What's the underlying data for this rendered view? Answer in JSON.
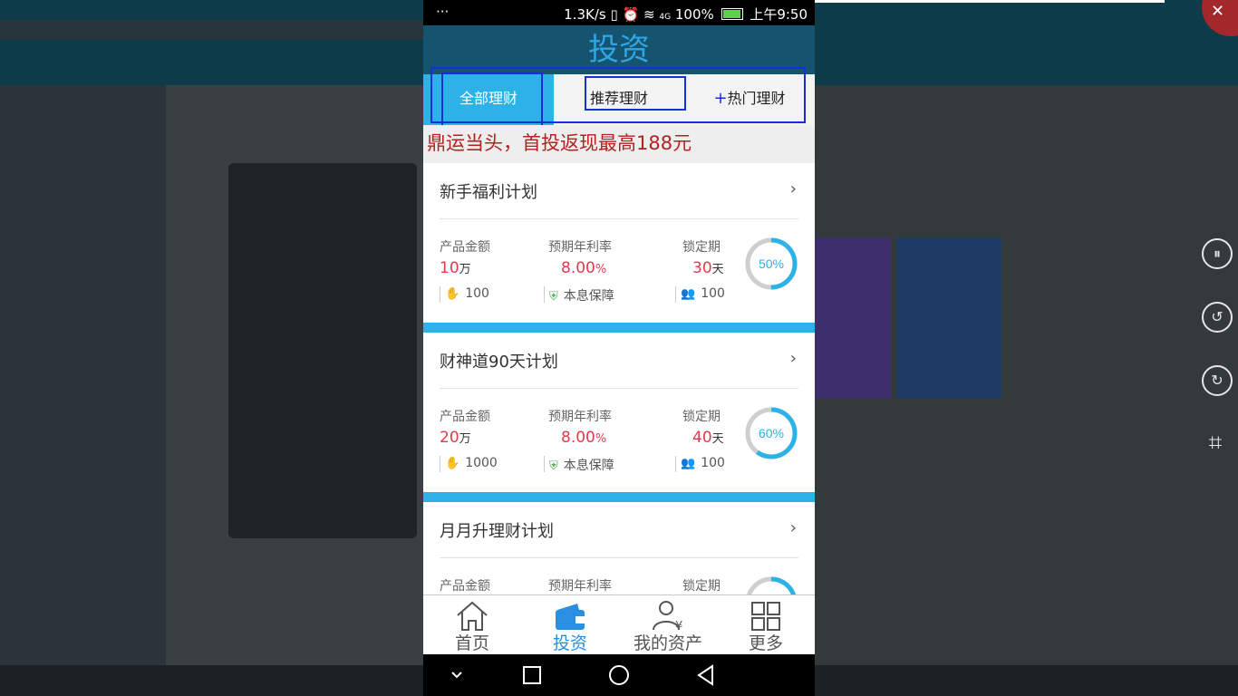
{
  "status_bar": {
    "left": "···",
    "speed": "1.3K/s",
    "network": "4G",
    "battery_pct": "100%",
    "time": "上午9:50"
  },
  "page": {
    "title": "投资"
  },
  "tabs": [
    {
      "label": "全部理财",
      "active": true
    },
    {
      "label": "推荐理财",
      "active": false
    },
    {
      "label": "热门理财",
      "active": false,
      "prefix": "+"
    }
  ],
  "marquee": {
    "text": "鼎运当头，首投返现最高188元"
  },
  "labels": {
    "amount": "产品金额",
    "rate": "预期年利率",
    "lock": "锁定期"
  },
  "products": [
    {
      "name": "新手福利计划",
      "amount": "10",
      "amount_unit": "万",
      "rate": "8.00",
      "rate_unit": "%",
      "lock": "30",
      "lock_unit": "天",
      "min": "100",
      "guarantee": "本息保障",
      "buyers": "100",
      "progress_label": "50%",
      "progress": 0.5
    },
    {
      "name": "财神道90天计划",
      "amount": "20",
      "amount_unit": "万",
      "rate": "8.00",
      "rate_unit": "%",
      "lock": "40",
      "lock_unit": "天",
      "min": "1000",
      "guarantee": "本息保障",
      "buyers": "100",
      "progress_label": "60%",
      "progress": 0.6
    },
    {
      "name": "月月升理财计划",
      "amount": "",
      "amount_unit": "",
      "rate": "",
      "rate_unit": "",
      "lock": "",
      "lock_unit": "",
      "min": "",
      "guarantee": "",
      "buyers": "",
      "progress_label": "",
      "progress": 0.7
    }
  ],
  "bottom_nav": [
    {
      "label": "首页",
      "icon": "home-icon",
      "active": false
    },
    {
      "label": "投资",
      "icon": "wallet-icon",
      "active": true
    },
    {
      "label": "我的资产",
      "icon": "user-assets-icon",
      "active": false
    },
    {
      "label": "更多",
      "icon": "grid-icon",
      "active": false
    }
  ],
  "colors": {
    "accent": "#2db2e8",
    "title_bar": "#16536f",
    "red": "#e23a4c",
    "highlight": "#1330d6"
  }
}
